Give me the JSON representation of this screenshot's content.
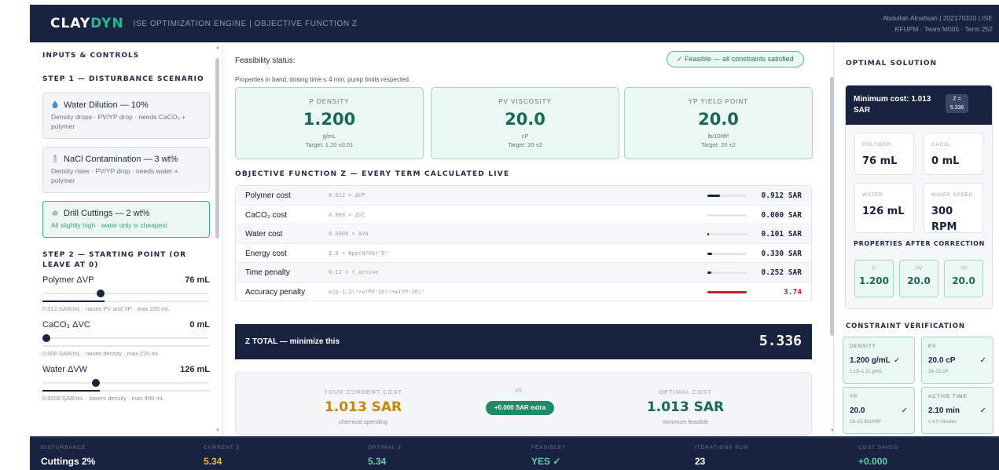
{
  "header": {
    "brand_a": "CLAY",
    "brand_b": "DYN",
    "subtitle": "ISE OPTIMIZATION ENGINE  |  OBJECTIVE FUNCTION Z",
    "user_line1": "Abdullah Alnafisah  |  202170310  |  ISE",
    "user_line2": "KFUPM · Team M005 · Term 252"
  },
  "left": {
    "title": "INPUTS & CONTROLS",
    "step1_title": "STEP 1 — DISTURBANCE SCENARIO",
    "scenarios": [
      {
        "icon": "droplet-icon",
        "title": "Water Dilution — 10%",
        "desc": "Density drops · PV/YP drop · needs CaCO₃ + polymer",
        "active": false
      },
      {
        "icon": "salt-shaker-icon",
        "title": "NaCl Contamination — 3 wt%",
        "desc": "Density rises · PV/YP drop · needs water + polymer",
        "active": false
      },
      {
        "icon": "rock-icon",
        "title": "Drill Cuttings — 2 wt%",
        "desc": "All slightly high · water only is cheapest",
        "active": true
      }
    ],
    "step2_title": "STEP 2 — STARTING POINT (OR LEAVE AT 0)",
    "sliders": [
      {
        "label": "Polymer ΔVP",
        "value": "76 mL",
        "note": "0.012 SAR/mL · raises PV and YP · max 220 mL",
        "level": 0.345
      },
      {
        "label": "CaCO₃ ΔVC",
        "value": "0 mL",
        "note": "0.006 SAR/mL · raises density · max 220 mL",
        "level": 0.0
      },
      {
        "label": "Water ΔVW",
        "value": "126 mL",
        "note": "0.0008 SAR/mL · lowers density · max 400 mL",
        "level": 0.315
      }
    ]
  },
  "main": {
    "feasibility_label": "Feasibility status:",
    "feasibility_badge": "✓ Feasible — all constraints satisfied",
    "feasibility_note": "Properties in band, dosing time ≤ 4 min, pump limits respected.",
    "metrics": [
      {
        "label": "Ρ DENSITY",
        "value": "1.200",
        "unit": "g/mL",
        "target": "Target: 1.20 ±0.01"
      },
      {
        "label": "PV VISCOSITY",
        "value": "20.0",
        "unit": "cP",
        "target": "Target: 20 ±2"
      },
      {
        "label": "YP YIELD POINT",
        "value": "20.0",
        "unit": "lb/100ft²",
        "target": "Target: 20 ±2"
      }
    ],
    "objective_title": "OBJECTIVE FUNCTION Z — EVERY TERM CALCULATED LIVE",
    "terms": [
      {
        "name": "Polymer cost",
        "formula": "0.012 × ΔVP",
        "value": "0.912 SAR",
        "share": 0.32,
        "color": "#17233f",
        "value_color": "#17233f"
      },
      {
        "name": "CaCO₃ cost",
        "formula": "0.006 × ΔVC",
        "value": "0.000 SAR",
        "share": 0.0,
        "color": "#17233f",
        "value_color": "#17233f"
      },
      {
        "name": "Water cost",
        "formula": "0.0008 × ΔVW",
        "value": "0.101 SAR",
        "share": 0.04,
        "color": "#17233f",
        "value_color": "#17233f"
      },
      {
        "name": "Energy cost",
        "formula": "8.0 × Npp(N/60)³D⁵",
        "value": "0.330 SAR",
        "share": 0.12,
        "color": "#17233f",
        "value_color": "#17233f"
      },
      {
        "name": "Time penalty",
        "formula": "0.12 × t_active",
        "value": "0.252 SAR",
        "share": 0.09,
        "color": "#17233f",
        "value_color": "#17233f"
      },
      {
        "name": "Accuracy penalty",
        "formula": "w(ρ-1.2)²+w(PV-20)²+w(YP-20)²",
        "value": "3.74",
        "share": 1.0,
        "color": "#c81e2a",
        "value_color": "#c81e2a"
      }
    ],
    "total_label": "Z TOTAL — minimize this",
    "total_value": "5.336",
    "compare": {
      "current_label": "YOUR CURRENT COST",
      "current_value": "1.013 SAR",
      "current_sub": "chemical spending",
      "vs": "VS.",
      "extra": "+0.000 SAR extra",
      "optimal_label": "OPTIMAL COST",
      "optimal_value": "1.013 SAR",
      "optimal_sub": "minimum feasible",
      "current_color": "#c9860c",
      "optimal_color": "#176a54"
    }
  },
  "right": {
    "title": "OPTIMAL SOLUTION",
    "head_title": "Minimum cost: 1.013 SAR",
    "head_z1": "Z =",
    "head_z2": "5.336",
    "cards": [
      {
        "label": "POLYMER",
        "value": "76 mL"
      },
      {
        "label": "CACO₃",
        "value": "0 mL"
      },
      {
        "label": "WATER",
        "value": "126 mL"
      },
      {
        "label": "MIXER SPEED",
        "value": "300 RPM"
      }
    ],
    "props_title": "PROPERTIES AFTER CORRECTION",
    "props": [
      {
        "label": "Ρ",
        "value": "1.200"
      },
      {
        "label": "PV",
        "value": "20.0"
      },
      {
        "label": "YP",
        "value": "20.0"
      }
    ],
    "verify_title": "CONSTRAINT VERIFICATION",
    "verify": [
      {
        "label": "DENSITY",
        "value": "1.200 g/mL",
        "check": "✓",
        "range": "1.19–1.21 g/mL"
      },
      {
        "label": "PV",
        "value": "20.0 cP",
        "check": "✓",
        "range": "18–22 cP"
      },
      {
        "label": "YP",
        "value": "20.0",
        "check": "✓",
        "range": "18–22 lb/100ft²"
      },
      {
        "label": "ACTIVE TIME",
        "value": "2.10 min",
        "check": "✓",
        "range": "≤ 4.0 minutes"
      }
    ]
  },
  "footer": [
    {
      "label": "DISTURBANCE",
      "value": "Cuttings 2%",
      "color": "#ffffff"
    },
    {
      "label": "CURRENT Z",
      "value": "5.34",
      "color": "#e9b949"
    },
    {
      "label": "OPTIMAL Z",
      "value": "5.34",
      "color": "#5fd3a8"
    },
    {
      "label": "FEASIBLE?",
      "value": "YES ✓",
      "color": "#5fd3a8"
    },
    {
      "label": "ITERATIONS RUN",
      "value": "23",
      "color": "#ffffff"
    },
    {
      "label": "COST SAVED",
      "value": "+0.000",
      "color": "#5fd3a8"
    }
  ]
}
